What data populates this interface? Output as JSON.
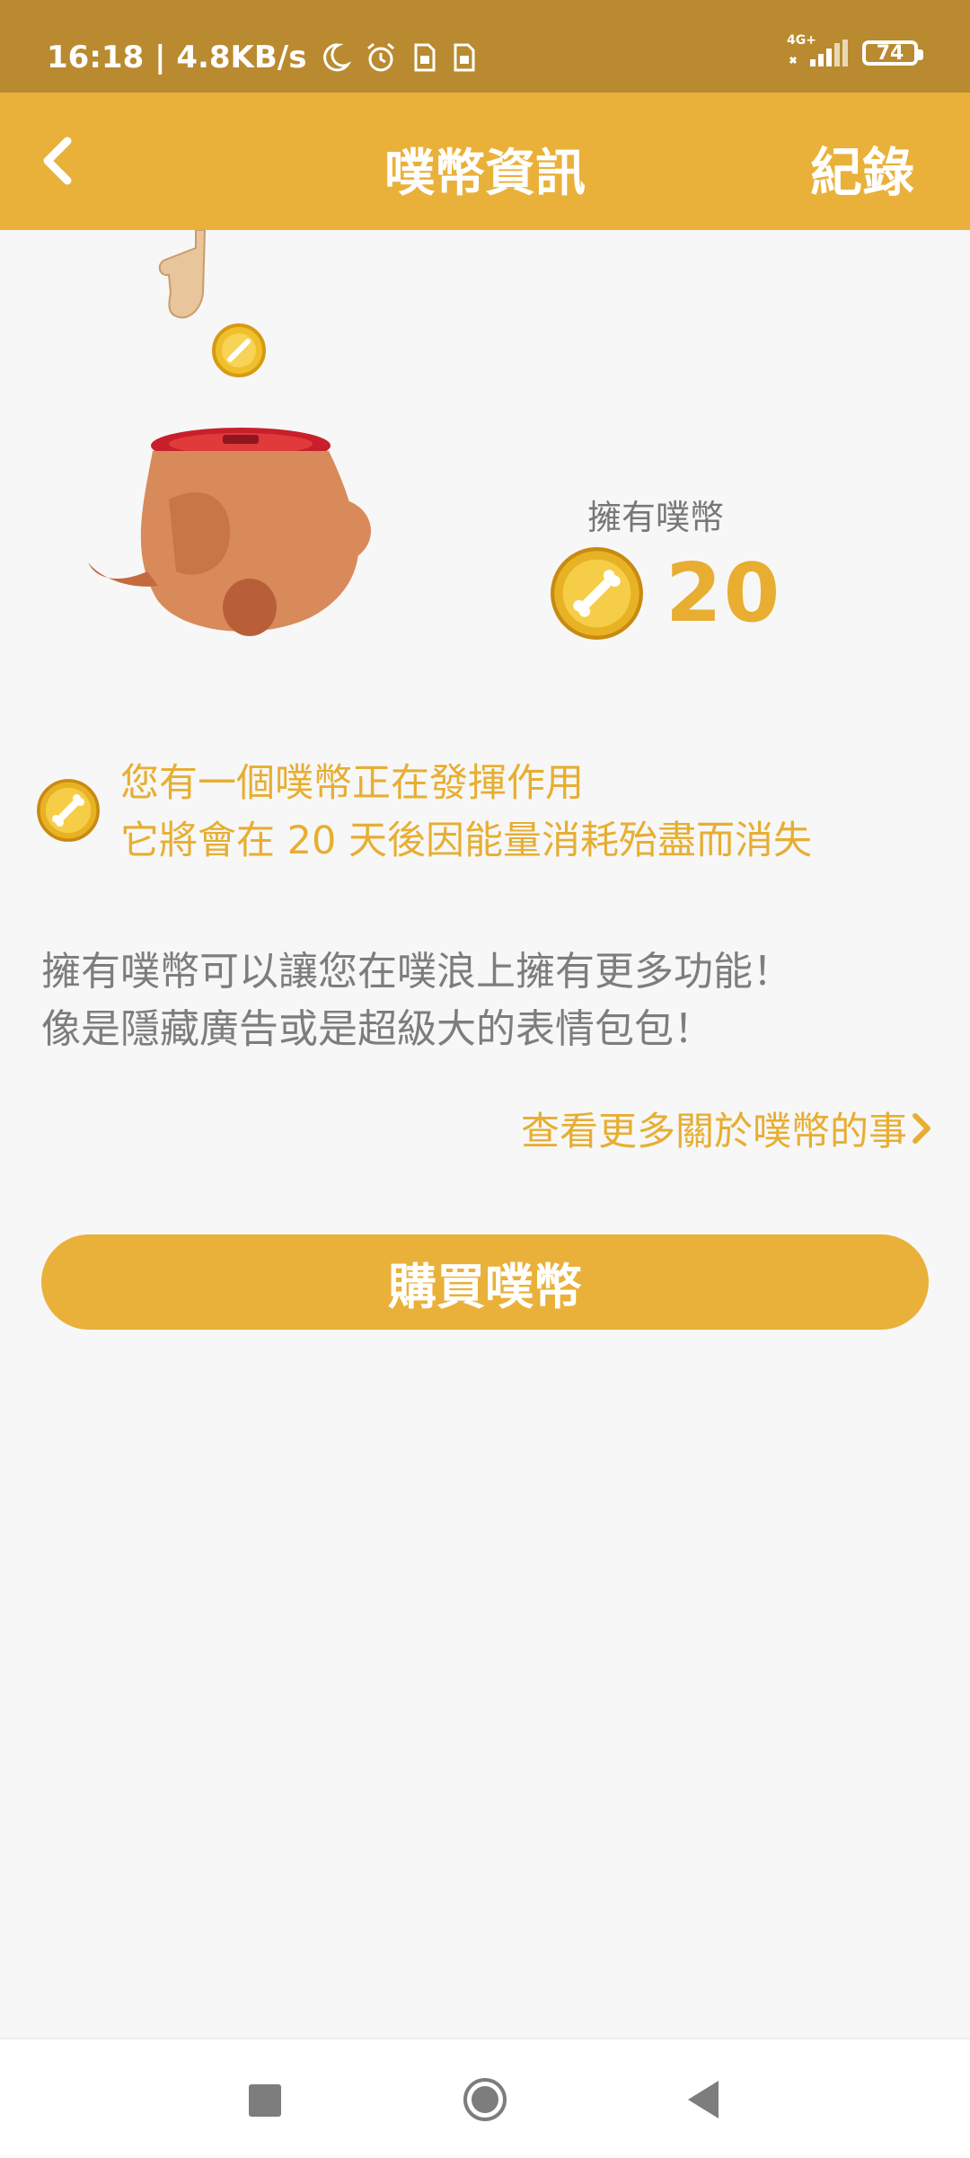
{
  "status_bar": {
    "time_speed": "16:18 | 4.8KB/s",
    "network": "4G+",
    "battery": "74"
  },
  "header": {
    "title": "噗幣資訊",
    "records_label": "紀錄",
    "back_icon": "chevron-left-icon"
  },
  "balance": {
    "label": "擁有噗幣",
    "value": "20"
  },
  "notice": {
    "line1": "您有一個噗幣正在發揮作用",
    "line2": "它將會在 20 天後因能量消耗殆盡而消失"
  },
  "description": {
    "line1": "擁有噗幣可以讓您在噗浪上擁有更多功能！",
    "line2": "像是隱藏廣告或是超級大的表情包包！"
  },
  "links": {
    "more": "查看更多關於噗幣的事"
  },
  "buttons": {
    "buy": "購買噗幣"
  },
  "colors": {
    "accent": "#e9b13a",
    "status_bar": "#b98a2f",
    "text_gray": "#7d7d7d"
  }
}
